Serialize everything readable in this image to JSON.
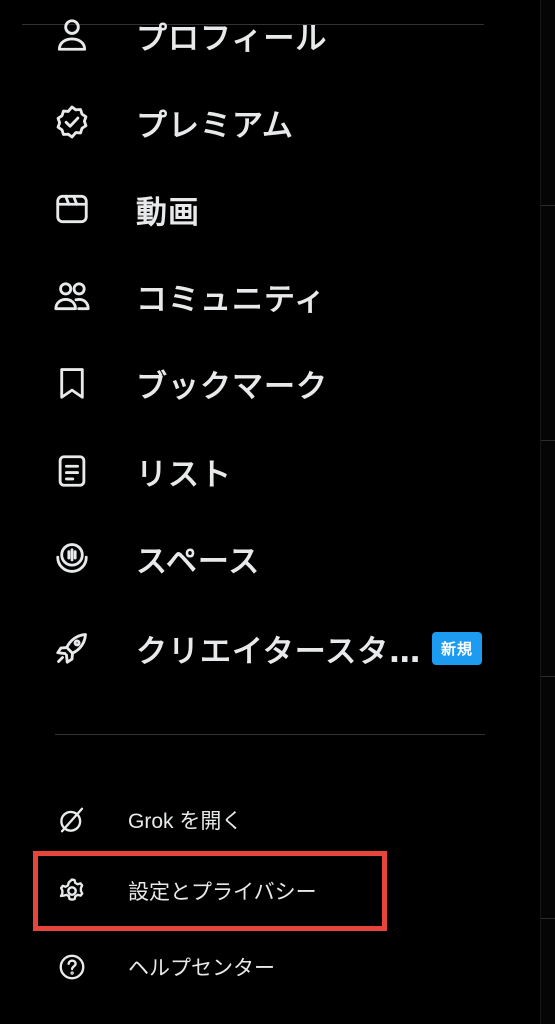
{
  "menu": {
    "items": [
      {
        "label": "プロフィール",
        "icon": "person-icon"
      },
      {
        "label": "プレミアム",
        "icon": "verified-badge-icon"
      },
      {
        "label": "動画",
        "icon": "video-icon"
      },
      {
        "label": "コミュニティ",
        "icon": "communities-icon"
      },
      {
        "label": "ブックマーク",
        "icon": "bookmark-icon"
      },
      {
        "label": "リスト",
        "icon": "list-icon"
      },
      {
        "label": "スペース",
        "icon": "spaces-icon"
      },
      {
        "label": "クリエイタースタ…",
        "icon": "rocket-icon",
        "badge": "新規"
      }
    ]
  },
  "secondary": {
    "items": [
      {
        "label": "Grok を開く",
        "icon": "grok-icon"
      },
      {
        "label": "設定とプライバシー",
        "icon": "gear-icon"
      },
      {
        "label": "ヘルプセンター",
        "icon": "help-icon"
      }
    ]
  },
  "colors": {
    "background": "#000000",
    "text": "#e7e9ea",
    "badge": "#1d9bf0",
    "highlight": "#e5453a",
    "divider": "#2f3336"
  }
}
